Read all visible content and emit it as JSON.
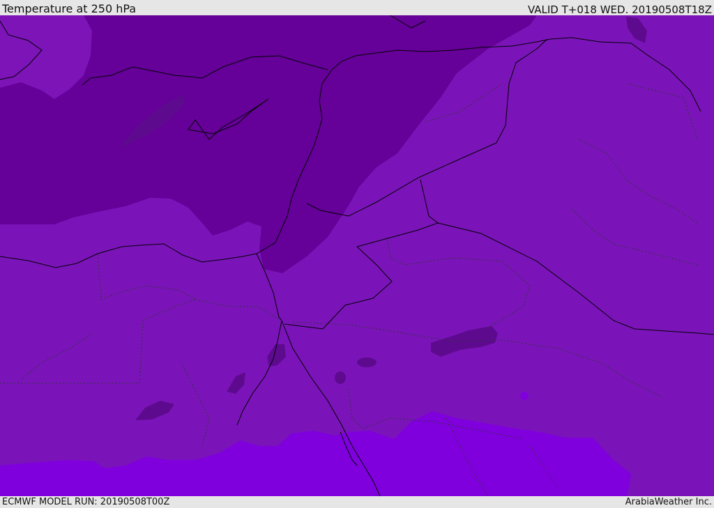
{
  "header": {
    "title": "Temperature at 250 hPa",
    "valid": "VALID T+018 WED. 20190508T18Z"
  },
  "footer": {
    "model_run": "ECMWF MODEL RUN: 20190508T00Z",
    "credit": "ArabiaWeather Inc."
  },
  "map": {
    "parameter": "temperature",
    "level": "250 hPa",
    "region": "Eastern Mediterranean, Egypt, Levant, Arabian Peninsula",
    "colors": {
      "coldest_zone": "#650098",
      "cold_zone": "#7412b0",
      "base_zone": "#7a14b8",
      "warm_zone": "#7f00dd",
      "cold_pockets": "#5e0a8f",
      "coastlines": "#000000",
      "borders": "#333333"
    }
  }
}
